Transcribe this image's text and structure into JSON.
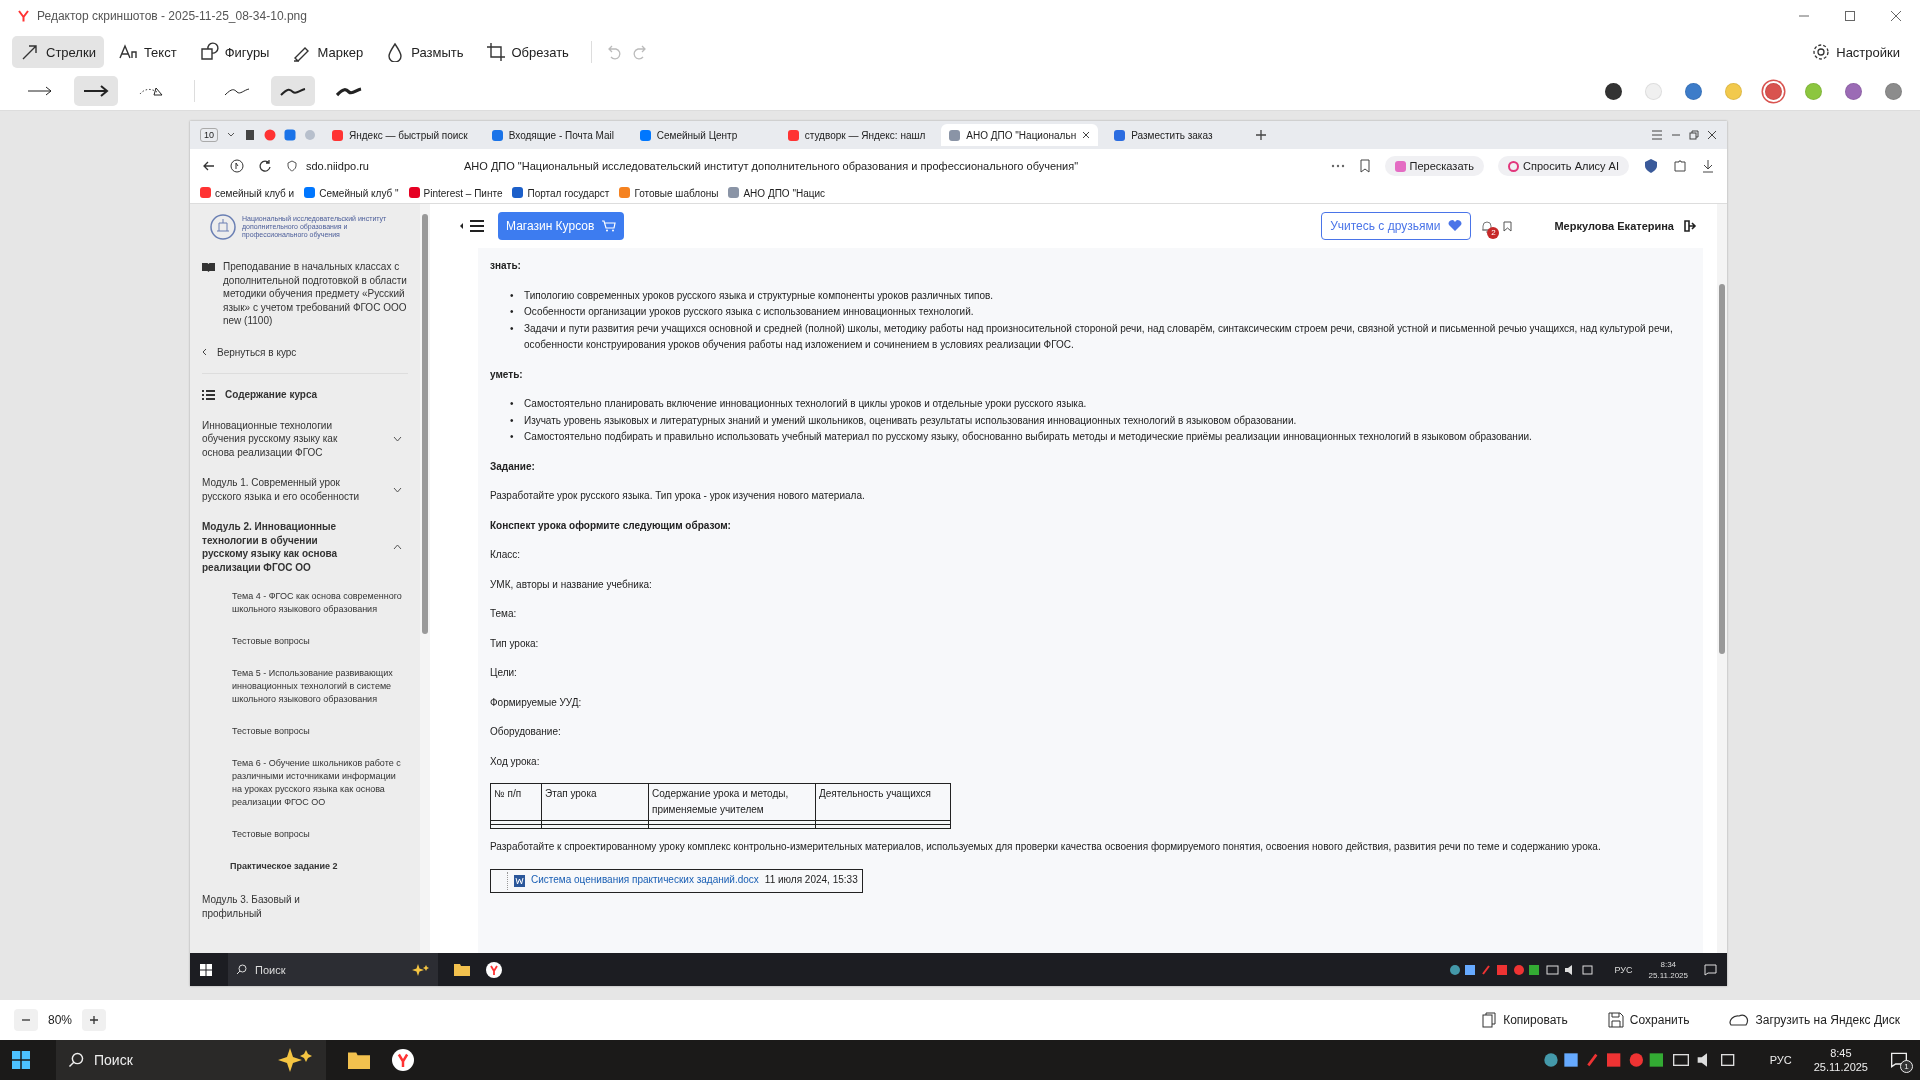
{
  "window": {
    "title": "Редактор скриншотов - 2025-11-25_08-34-10.png"
  },
  "tools": [
    {
      "label": "Стрелки",
      "kind": "arrow",
      "selected": true
    },
    {
      "label": "Текст",
      "kind": "text",
      "selected": false
    },
    {
      "label": "Фигуры",
      "kind": "shapes",
      "selected": false
    },
    {
      "label": "Маркер",
      "kind": "marker",
      "selected": false
    },
    {
      "label": "Размыть",
      "kind": "blur",
      "selected": false
    },
    {
      "label": "Обрезать",
      "kind": "crop",
      "selected": false
    }
  ],
  "settings_label": "Настройки",
  "arrow_styles": [
    {
      "kind": "thin",
      "selected": false
    },
    {
      "kind": "bold",
      "selected": true
    },
    {
      "kind": "dotted",
      "selected": false
    }
  ],
  "line_styles": [
    {
      "kind": "thin",
      "selected": false
    },
    {
      "kind": "medium",
      "selected": true
    },
    {
      "kind": "thick",
      "selected": false
    }
  ],
  "colors": [
    {
      "color": "#333333",
      "selected": false
    },
    {
      "color": "#f0f0f0",
      "selected": false
    },
    {
      "color": "#3d7cc9",
      "selected": false
    },
    {
      "color": "#f2c94c",
      "selected": false
    },
    {
      "color": "#d9534f",
      "selected": true
    },
    {
      "color": "#8cc63f",
      "selected": false
    },
    {
      "color": "#9b6bb5",
      "selected": false
    },
    {
      "color": "#8c8c8c",
      "selected": false
    }
  ],
  "browser": {
    "tab_count": "10",
    "tabs": [
      {
        "label": "Яндекс — быстрый поиск",
        "kind": "yandex",
        "selected": false
      },
      {
        "label": "Входящие - Почта Mail",
        "kind": "mail",
        "selected": false
      },
      {
        "label": "Семейный Центр",
        "kind": "vk",
        "selected": false
      },
      {
        "label": "студворк — Яндекс: нашл",
        "kind": "yandex",
        "selected": false
      },
      {
        "label": "АНО ДПО \"Национальн",
        "kind": "crest",
        "selected": true
      },
      {
        "label": "Разместить заказ",
        "kind": "edit",
        "selected": false
      }
    ],
    "address": "sdo.niidpo.ru",
    "page_title": "АНО ДПО \"Национальный исследовательский институт дополнительного образования и профессионального обучения\"",
    "retell_button": "Пересказать",
    "alice_button": "Спросить Алису AI",
    "bookmarks": [
      {
        "label": "семейный клуб и",
        "kind": "yandex"
      },
      {
        "label": "Семейный клуб \"",
        "kind": "vk"
      },
      {
        "label": "Pinterest – Пинте",
        "kind": "pinterest"
      },
      {
        "label": "Портал государст",
        "kind": "flag"
      },
      {
        "label": "Готовые шаблоны",
        "kind": "ring"
      },
      {
        "label": "АНО ДПО \"Нацис",
        "kind": "crest"
      }
    ]
  },
  "sidebar": {
    "logo_text": "Национальный исследовательский институт дополнительного образования и профессионального обучения",
    "course_title": "Преподавание в начальных классах с дополнительной подготовкой в области методики обучения предмету «Русский язык» с учетом требований ФГОС ООО new (1100)",
    "back_link": "Вернуться в курс",
    "contents_heading": "Содержание курса",
    "items": [
      {
        "label": "Инновационные технологии обучения русскому языку как основа реализации ФГОС",
        "expanded": false
      },
      {
        "label": "Модуль 1. Современный урок русского языка и его особенности",
        "expanded": false
      },
      {
        "label": "Модуль 2. Инновационные технологии в обучении русскому языку как основа реализации ФГОС ОО",
        "expanded": true,
        "children": [
          {
            "label": "Тема 4 - ФГОС как основа современного школьного языкового образования",
            "selected": false
          },
          {
            "label": "Тестовые вопросы",
            "selected": false
          },
          {
            "label": "Тема 5 - Использование развивающих инновационных технологий в системе школьного языкового образования",
            "selected": false
          },
          {
            "label": "Тестовые вопросы",
            "selected": false
          },
          {
            "label": "Тема 6 - Обучение школьников работе с различными источниками информации на уроках русского языка как основа реализации ФГОС ОО",
            "selected": false
          },
          {
            "label": "Тестовые вопросы",
            "selected": false
          },
          {
            "label": "Практическое задание 2",
            "selected": true
          }
        ]
      },
      {
        "label": "Модуль 3. Базовый и профильный"
      }
    ]
  },
  "header": {
    "shop_button": "Магазин Курсов",
    "friends_button": "Учитесь с друзьями",
    "notification_count": "2",
    "user_name": "Меркулова Екатерина"
  },
  "content": [
    {
      "kind": "heading",
      "text": "знать:"
    },
    {
      "kind": "list",
      "marker": "•",
      "items": [
        "Типологию современных уроков русского языка и структурные компоненты уроков различных типов.",
        "Особенности организации уроков русского языка с использованием инновационных технологий.",
        "Задачи и пути развития речи учащихся основной и средней (полной) школы, методику работы над произносительной стороной речи, над словарём, синтаксическим строем речи, связной устной и письменной речью учащихся, над культурой речи, особенности конструирования уроков обучения работы над изложением и сочинением в условиях реализации ФГОС."
      ]
    },
    {
      "kind": "heading",
      "text": "уметь:"
    },
    {
      "kind": "list",
      "marker": "•",
      "items": [
        "Самостоятельно планировать включение инновационных технологий в  циклы уроков и отдельные уроки русского языка.",
        "Изучать уровень языковых и литературных знаний и умений школьников, оценивать результаты использования инновационных технологий в языковом образовании.",
        "Самостоятельно подбирать и правильно использовать учебный материал по русскому языку, обоснованно выбирать методы и методические приёмы реализации инновационных технологий в языковом образовании."
      ]
    },
    {
      "kind": "heading",
      "text": "Задание:"
    },
    {
      "kind": "paragraph",
      "text": "Разработайте урок русского языка. Тип урока - урок изучения нового материала."
    },
    {
      "kind": "heading",
      "text": "Конспект урока оформите следующим образом:"
    },
    {
      "kind": "paragraph",
      "text": "Класс:"
    },
    {
      "kind": "paragraph",
      "text": "УМК, авторы и название учебника:"
    },
    {
      "kind": "paragraph",
      "text": "Тема:"
    },
    {
      "kind": "paragraph",
      "text": "Тип урока:"
    },
    {
      "kind": "paragraph",
      "text": "Цели:"
    },
    {
      "kind": "paragraph",
      "text": "Формируемые УУД:"
    },
    {
      "kind": "paragraph",
      "text": "Оборудование:"
    },
    {
      "kind": "paragraph",
      "text": "Ход урока:"
    },
    {
      "kind": "table",
      "columns": [
        "№ п/п",
        "Этап урока",
        "Содержание урока и методы, применяемые учителем",
        "Деятельность учащихся"
      ]
    },
    {
      "kind": "paragraph",
      "text": "Разработайте к спроектированному уроку комплекс контрольно-измерительных материалов, используемых для проверки качества освоения формируемого понятия, освоения нового действия, развития речи по теме и содержанию урока."
    },
    {
      "kind": "file",
      "name": "Система оценивания практических заданий.docx",
      "date": "11 июля 2024, 15:33"
    }
  ],
  "inner_taskbar": {
    "search": "Поиск",
    "language": "РУС",
    "time": "8:34",
    "date": "25.11.2025"
  },
  "editor_footer": {
    "zoom": "80%",
    "copy_button": "Копировать",
    "save_button": "Сохранить",
    "upload_button": "Загрузить на Яндекс Диск"
  },
  "taskbar": {
    "search": "Поиск",
    "language": "РУС",
    "time": "8:45",
    "date": "25.11.2025",
    "notification_count": "1"
  }
}
